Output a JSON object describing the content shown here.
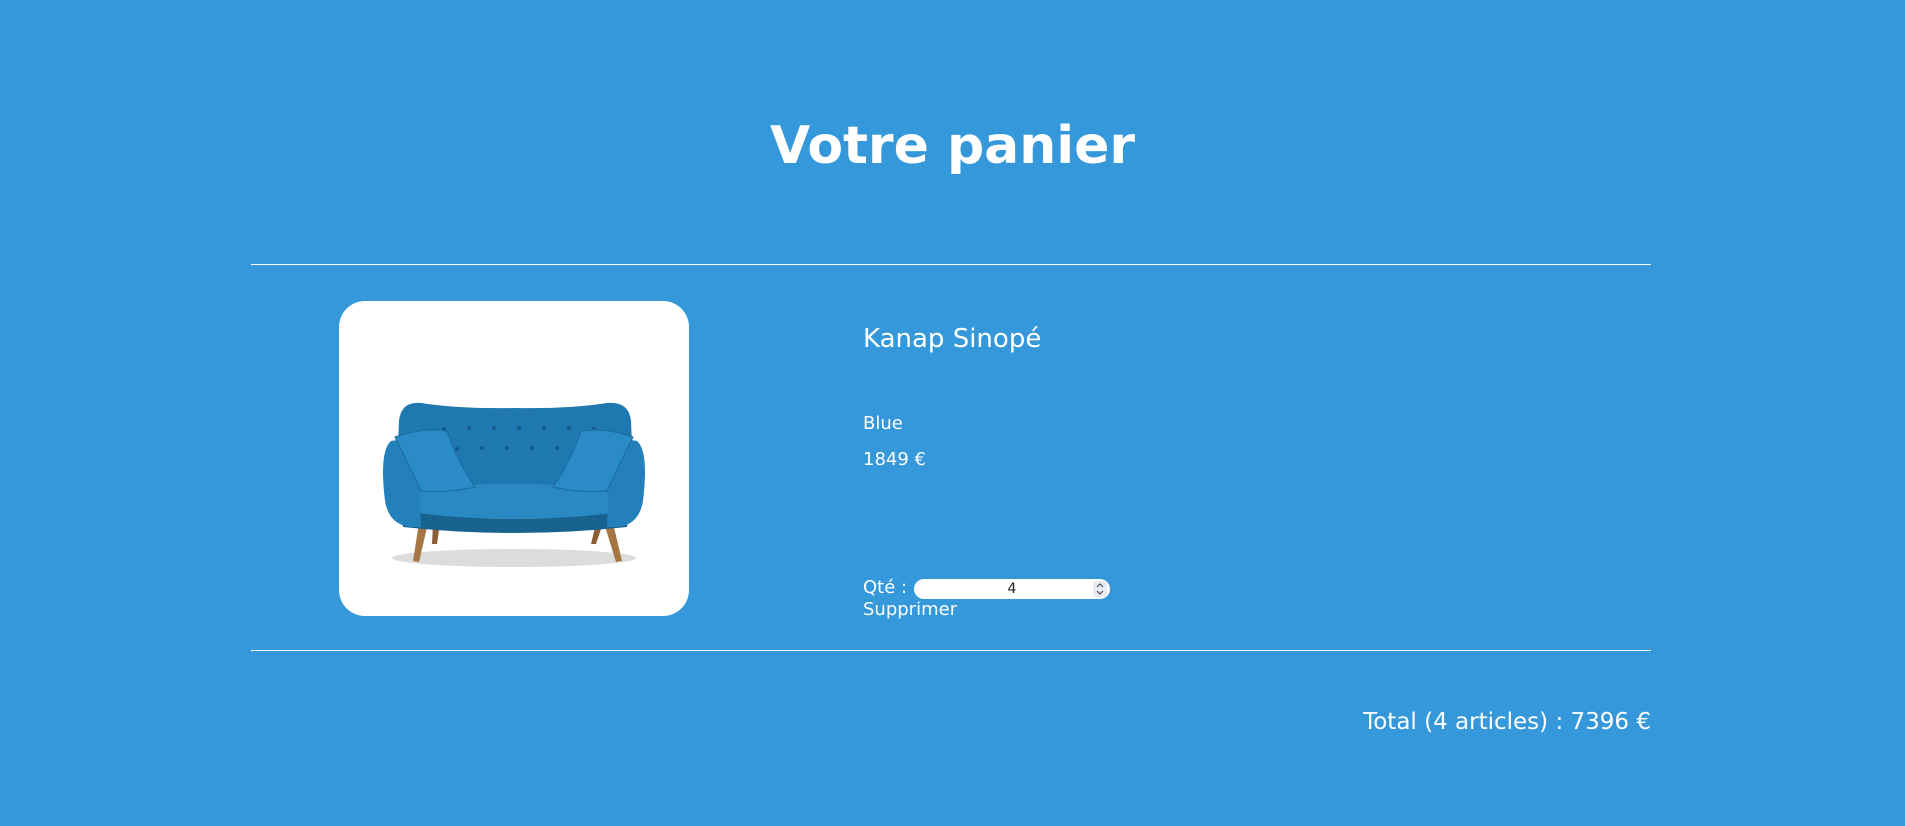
{
  "page": {
    "title": "Votre panier",
    "background_color": "#3498db"
  },
  "cart": {
    "items": [
      {
        "name": "Kanap Sinopé",
        "color": "Blue",
        "price": "1849 €",
        "quantity_label": "Qté :",
        "quantity": "4",
        "delete_label": "Supprimer",
        "image": "blue-sofa"
      }
    ],
    "total": {
      "text": "Total (4 articles) : 7396 €"
    }
  }
}
